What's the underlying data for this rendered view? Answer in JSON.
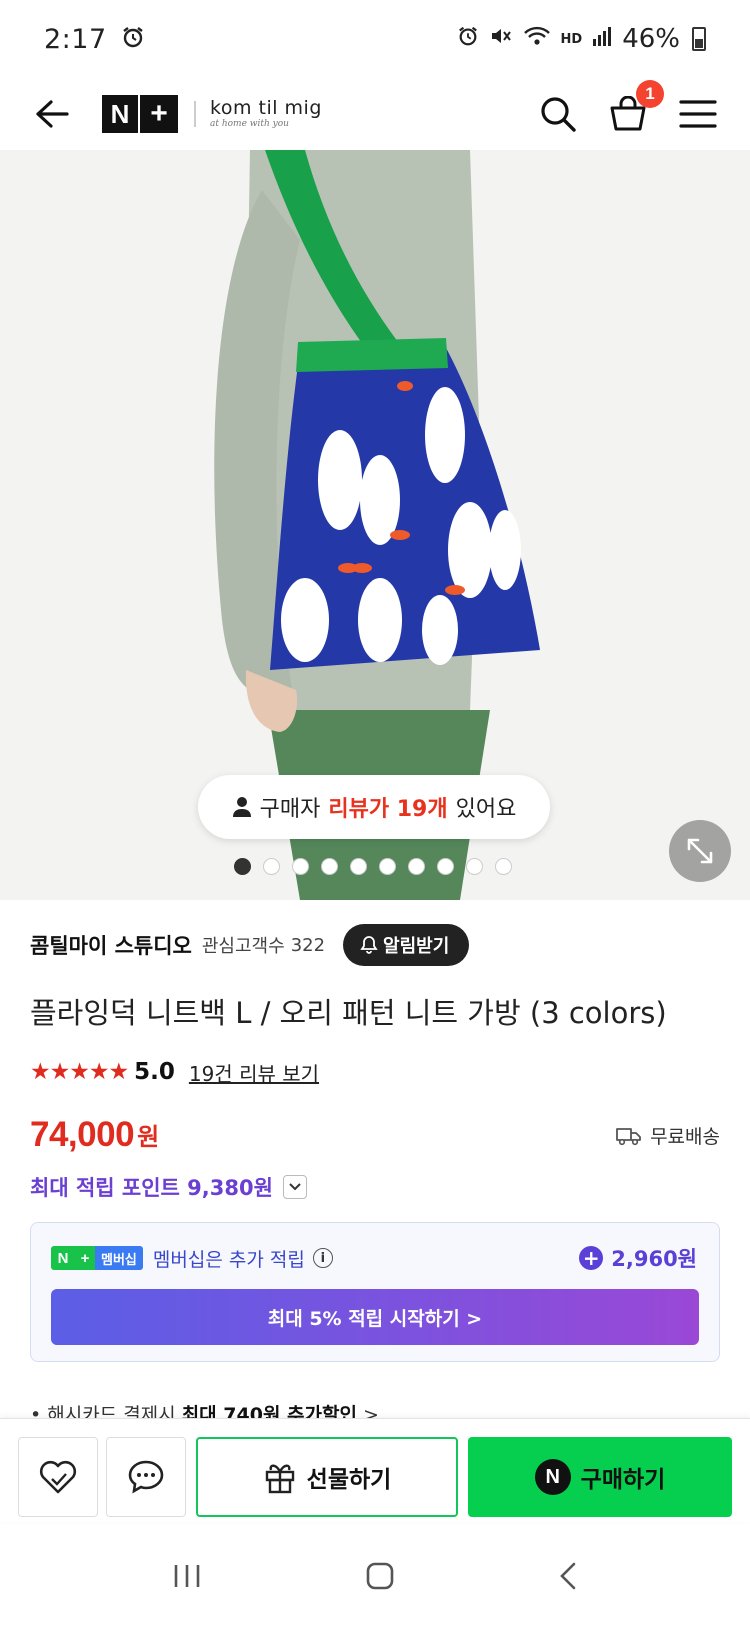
{
  "status_bar": {
    "time": "2:17",
    "battery": "46%",
    "network": "HD"
  },
  "header": {
    "logo_n": "N",
    "logo_plus": "+",
    "brand_name": "kom til mig",
    "brand_tagline": "at home with you",
    "cart_count": "1"
  },
  "gallery": {
    "review_pill_prefix": "구매자",
    "review_pill_highlight": "리뷰가 19개",
    "review_pill_suffix": "있어요",
    "image_count": 10,
    "active_index": 0
  },
  "store": {
    "name": "콤틸마이 스튜디오",
    "fans_label": "관심고객수",
    "fans_count": "322",
    "notify_label": "알림받기"
  },
  "product": {
    "title": "플라잉덕 니트백 L / 오리 패턴 니트 가방 (3 colors)",
    "stars": "★★★★★",
    "rating": "5.0",
    "review_link": "19건 리뷰 보기",
    "price": "74,000",
    "price_unit": "원",
    "shipping": "무료배송",
    "max_points": "최대 적립 포인트 9,380원"
  },
  "membership": {
    "badge_n": "N",
    "badge_plus": "+",
    "badge_label": "멤버십",
    "text": "멤버십은 추가 적립",
    "amount": "2,960원",
    "cta": "최대 5% 적립 시작하기 >"
  },
  "card_promo": {
    "prefix": "• 해시카드 결제시",
    "bold": "최대 740원 추가할인",
    "suffix": ">"
  },
  "actions": {
    "gift": "선물하기",
    "buy": "구매하기",
    "npay": "N"
  },
  "colors": {
    "accent_red": "#e02b1f",
    "naver_green": "#06cf4f",
    "points_purple": "#6a3fd1"
  }
}
